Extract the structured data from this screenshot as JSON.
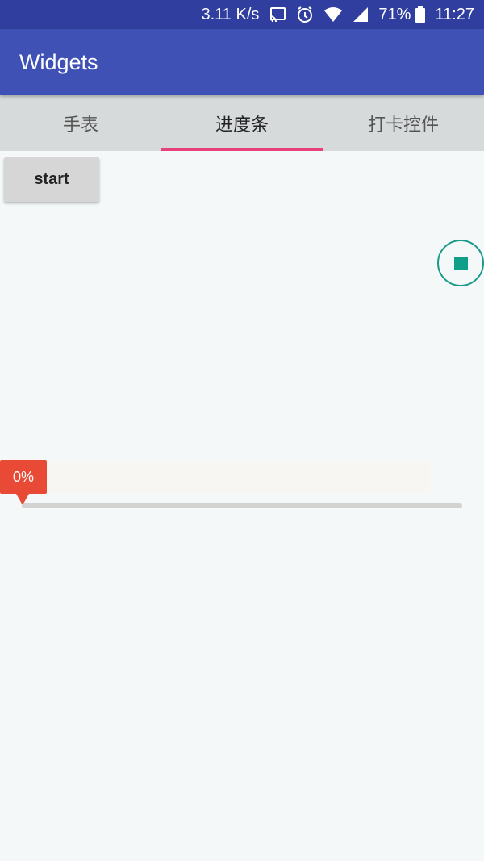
{
  "status_bar": {
    "speed": "3.11 K/s",
    "battery": "71%",
    "time": "11:27"
  },
  "app_bar": {
    "title": "Widgets"
  },
  "tabs": [
    {
      "label": "手表",
      "active": false
    },
    {
      "label": "进度条",
      "active": true
    },
    {
      "label": "打卡控件",
      "active": false
    }
  ],
  "content": {
    "start_label": "start",
    "progress": {
      "value_percent": 0,
      "label": "0%"
    }
  },
  "colors": {
    "primary": "#3f51b5",
    "primary_dark": "#303f9f",
    "tab_indicator": "#e8407a",
    "progress_accent": "#e94a35",
    "fab_accent": "#0f9f88"
  }
}
